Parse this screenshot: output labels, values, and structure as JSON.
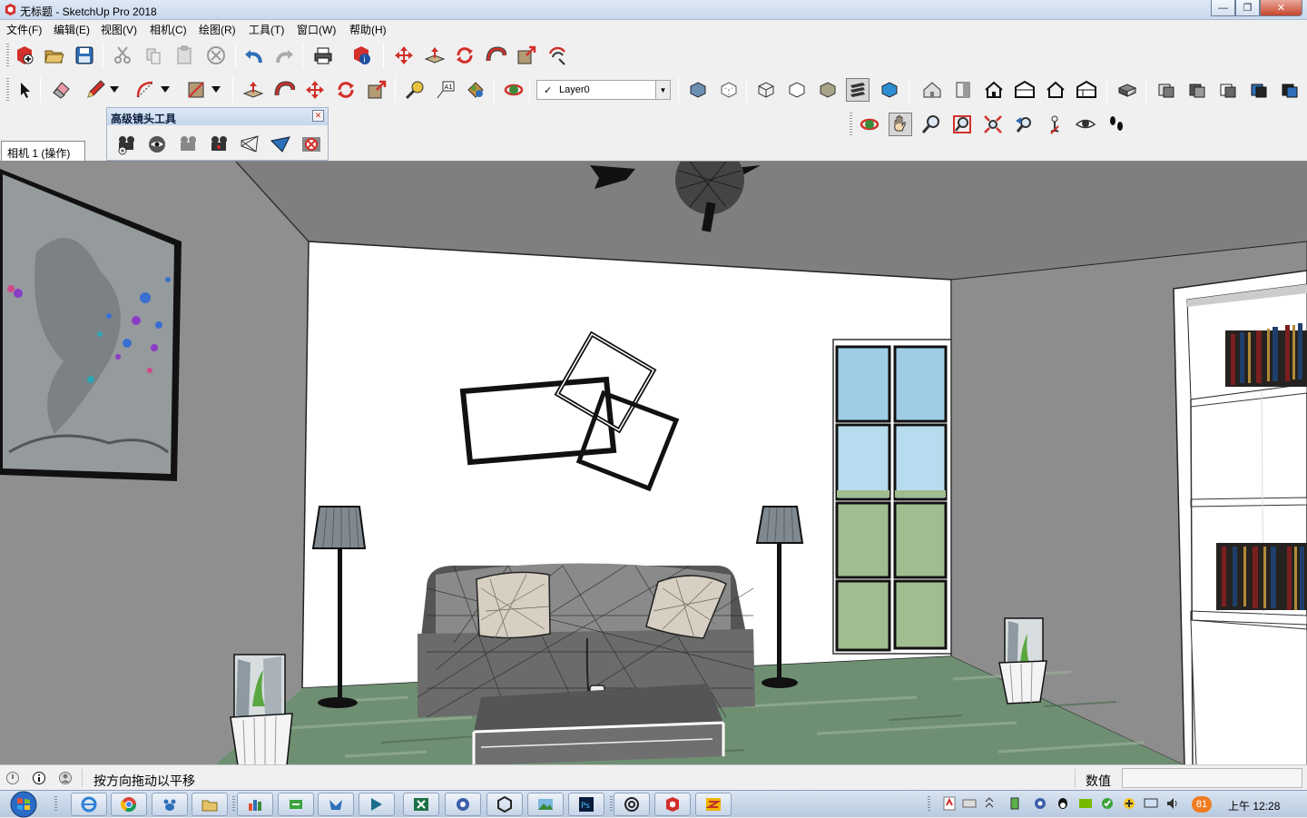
{
  "window": {
    "title": "无标题 - SketchUp Pro 2018",
    "minimize": "—",
    "restore": "❐",
    "close": "✕"
  },
  "menu": [
    "文件(F)",
    "编辑(E)",
    "视图(V)",
    "相机(C)",
    "绘图(R)",
    "工具(T)",
    "窗口(W)",
    "帮助(H)"
  ],
  "layer": {
    "check": "✓",
    "name": "Layer0",
    "drop": "▼"
  },
  "adv_camera": {
    "title": "高级镜头工具",
    "close": "✕"
  },
  "scene_tab": "相机 1 (操作)",
  "status": {
    "text": "按方向拖动以平移",
    "vcb_label": "数值",
    "vcb_value": ""
  },
  "taskbar": {
    "clock": "上午 12:28",
    "badge": "81"
  },
  "colors": {
    "wall_left": "#8f8f8f",
    "wall_back": "#ffffff",
    "ceiling": "#7f7f7f",
    "floor": "#6f8f73",
    "accent_red": "#d2302a"
  },
  "toolbar_icons": {
    "row1": [
      "new-file-icon",
      "open-file-icon",
      "save-icon",
      "cut-icon",
      "copy-icon",
      "paste-icon",
      "erase-icon",
      "undo-icon",
      "redo-icon",
      "print-icon",
      "model-info-icon",
      "move-icon",
      "push-pull-icon",
      "rotate-icon",
      "follow-me-icon",
      "scale-icon",
      "offset-icon"
    ],
    "row2": [
      "select-icon",
      "eraser-icon",
      "pencil-icon",
      "arc-icon",
      "rectangle-icon",
      "push-pull-icon",
      "follow-me-icon",
      "move-icon",
      "rotate-icon",
      "scale-icon",
      "tape-measure-icon",
      "text-icon",
      "paint-bucket-icon",
      "orbit-icon"
    ],
    "styles": [
      "xray-icon",
      "back-edges-icon",
      "wireframe-icon",
      "hidden-line-icon",
      "shaded-icon",
      "shaded-textures-icon",
      "monochrome-icon"
    ],
    "views": [
      "iso-view-icon",
      "top-view-icon",
      "front-view-icon",
      "right-view-icon",
      "back-view-icon",
      "left-view-icon"
    ],
    "sections": [
      "section-plane-icon",
      "section-cut-icon",
      "section-fill-icon",
      "section-display-icon",
      "solid-union-icon",
      "solid-subtract-icon"
    ],
    "camera": [
      "orbit-icon",
      "pan-icon",
      "zoom-icon",
      "zoom-window-icon",
      "zoom-extents-icon",
      "previous-view-icon",
      "position-camera-icon",
      "look-around-icon",
      "walk-icon"
    ],
    "adv_camera": [
      "create-camera-icon",
      "look-through-icon",
      "camera-properties-icon",
      "lock-camera-icon",
      "show-frustum-icon",
      "show-cameras-icon",
      "reset-camera-icon"
    ],
    "taskbar_apps": [
      "start-icon",
      "ie-icon",
      "chrome-icon",
      "baidu-icon",
      "explorer-icon",
      "app1-icon",
      "app2-icon",
      "app3-icon",
      "app4-icon",
      "excel-icon",
      "app5-icon",
      "unity-icon",
      "photo-icon",
      "photoshop-icon",
      "app6-icon",
      "sketchup-icon",
      "app7-icon"
    ]
  }
}
